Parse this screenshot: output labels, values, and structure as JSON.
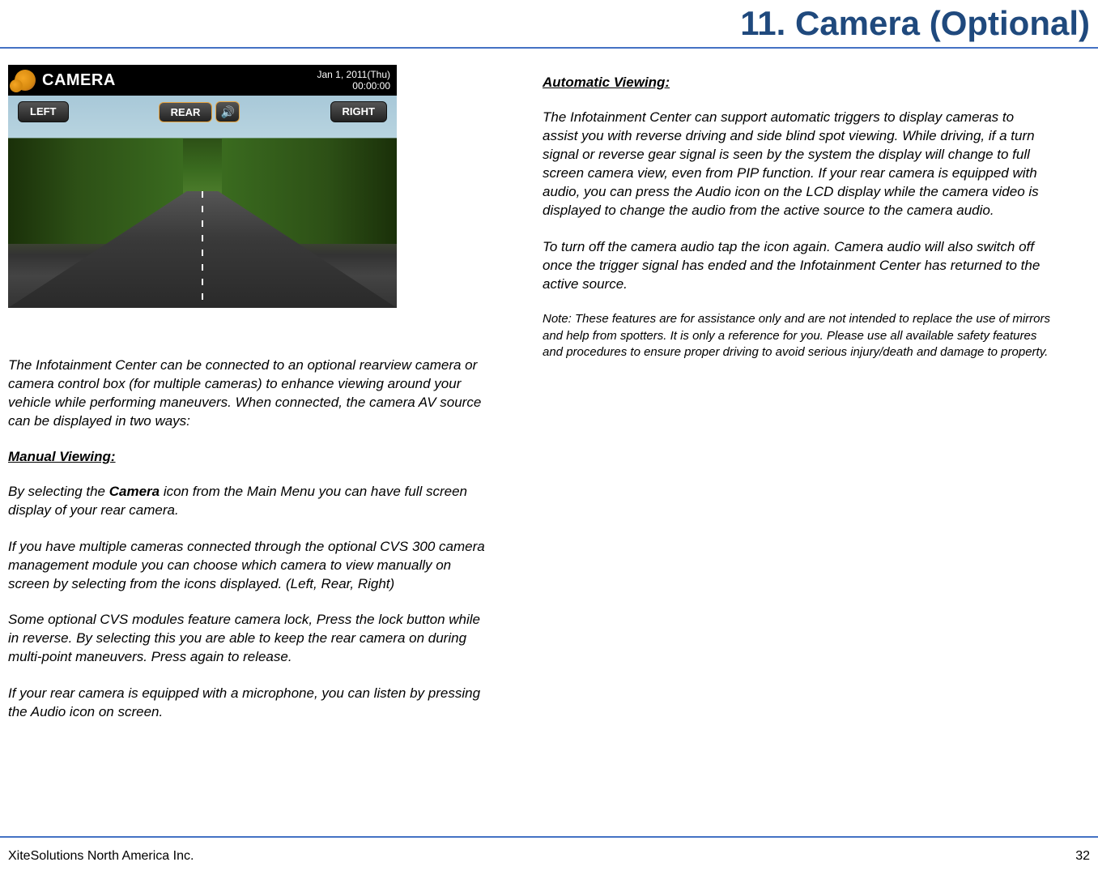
{
  "title": "11. Camera (Optional)",
  "screenshot": {
    "header_label": "CAMERA",
    "date": "Jan 1, 2011(Thu)",
    "time": "00:00:00",
    "btn_left": "LEFT",
    "btn_rear": "REAR",
    "btn_right": "RIGHT"
  },
  "left": {
    "intro": "The Infotainment Center can be connected to an optional rearview camera or camera control box (for multiple cameras) to enhance viewing around your vehicle while performing maneuvers. When connected, the camera AV source can be displayed in two ways:",
    "heading_manual": "Manual Viewing:",
    "p1_a": "By selecting the ",
    "p1_bold": "Camera",
    "p1_b": " icon from the Main Menu you can have full screen display of your rear camera.",
    "p2": "If you have multiple cameras connected through the optional CVS 300 camera management module you can choose which camera to view manually on screen by selecting from the icons displayed. (Left, Rear, Right)",
    "p3": "Some optional CVS modules feature camera lock, Press the lock button while in reverse. By selecting this you are able to keep the rear camera on during multi-point maneuvers. Press again to release.",
    "p4": "If your rear camera is equipped with a microphone, you can listen by pressing the Audio icon on screen."
  },
  "right": {
    "heading_auto": "Automatic Viewing:",
    "p1": "The Infotainment Center can support automatic triggers to display cameras to assist you with reverse driving and side blind spot viewing. While driving, if a turn signal or reverse gear signal is seen by the system the display will change to full screen camera view, even from PIP function. If your rear camera is equipped with audio, you can press the Audio icon on the LCD display while the camera video is displayed to change the audio from the active source to the camera audio.",
    "p2": "To turn off the camera audio tap the icon again. Camera audio will also switch off once the trigger signal has ended and the Infotainment Center has returned to the active source.",
    "note": "Note: These features are for assistance only and are not intended to replace the use of mirrors and help from spotters. It is only a reference for you. Please use all available safety features and procedures to ensure proper driving to avoid serious injury/death and damage to property."
  },
  "footer": {
    "company": "XiteSolutions North America Inc.",
    "page": "32"
  }
}
